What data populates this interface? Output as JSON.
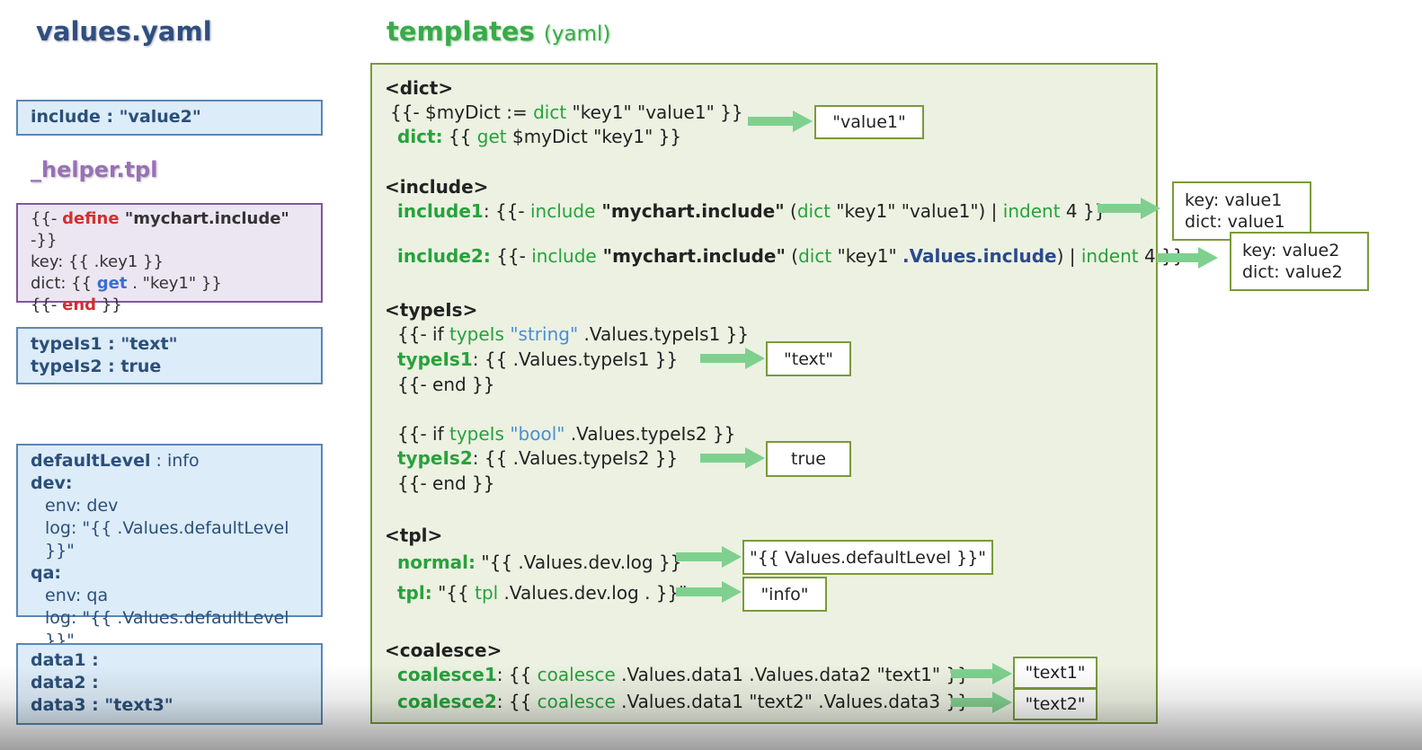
{
  "left": {
    "title": "values.yaml",
    "include_box": {
      "key": "include",
      "sep": " : ",
      "val": "\"value2\""
    },
    "helper_title": "_helper.tpl",
    "helper": {
      "l1_open": "{{- ",
      "l1_kw": "define",
      "l1_name": " \"mychart.include\"",
      "l1_close": " -}}",
      "l2": "key: {{ .key1 }}",
      "l3_pre": "dict: {{ ",
      "l3_kw": "get",
      "l3_post": " . \"key1\" }}",
      "l4_open": "{{- ",
      "l4_kw": "end",
      "l4_close": " }}"
    },
    "typeis_box": {
      "l1": "typeIs1 : \"text\"",
      "l2": "typeIs2 : true"
    },
    "level_box": {
      "l1_key": "defaultLevel",
      "l1_sep": " : ",
      "l1_val": "info",
      "l2": "dev:",
      "l3": "env: dev",
      "l4": "log: \"{{ .Values.defaultLevel }}\"",
      "l5": "qa:",
      "l6": "env: qa",
      "l7": "log: \"{{ .Values.defaultLevel }}\""
    },
    "data_box": {
      "l1": "data1 :",
      "l2": "data2 :",
      "l3": "data3 : \"text3\""
    }
  },
  "right": {
    "title": "templates",
    "subtitle": "(yaml)",
    "dict": {
      "header": "<dict>",
      "l1_a": "{{- $myDict := ",
      "l1_kw": "dict",
      "l1_b": " \"key1\" \"value1\" }}",
      "l2_key": "dict:",
      "l2_a": " {{ ",
      "l2_kw": "get",
      "l2_b": " $myDict \"key1\" }}",
      "out": "\"value1\""
    },
    "include": {
      "header": "<include>",
      "i1_key": "include1",
      "i1_a": ": {{- ",
      "i1_kw": "include",
      "i1_name": " \"mychart.include\"",
      "i1_b": " (",
      "i1_kw2": "dict",
      "i1_c": " \"key1\" \"value1\") | ",
      "i1_kw3": "indent",
      "i1_d": " 4 }}",
      "i2_key": "include2:",
      "i2_a": " {{- ",
      "i2_kw": "include",
      "i2_name": " \"mychart.include\"",
      "i2_b": " (",
      "i2_kw2": "dict",
      "i2_c": " \"key1\" ",
      "i2_val": ".Values.include",
      "i2_d": ") | ",
      "i2_kw3": "indent",
      "i2_e": " 4 }}",
      "out1_l1": "key: value1",
      "out1_l2": "dict: value1",
      "out2_l1": "key: value2",
      "out2_l2": "dict: value2"
    },
    "typeis": {
      "header": "<typeIs>",
      "a1_a": "{{- if ",
      "a1_kw": "typeIs",
      "a1_str": " \"string\"",
      "a1_b": " .Values.typeIs1 }}",
      "a2_key": "typeIs1",
      "a2_b": ": {{ .Values.typeIs1 }}",
      "a3": "{{- end }}",
      "out1": "\"text\"",
      "b1_a": "{{- if ",
      "b1_kw": "typeIs",
      "b1_str": " \"bool\"",
      "b1_b": " .Values.typeIs2 }}",
      "b2_key": "typeIs2",
      "b2_b": ": {{ .Values.typeIs2 }}",
      "b3": "{{- end }}",
      "out2": "true"
    },
    "tpl": {
      "header": "<tpl>",
      "n_key": "normal:",
      "n_b": " \"{{ .Values.dev.log }}\"",
      "t_key": "tpl:",
      "t_a": " \"{{ ",
      "t_kw": "tpl",
      "t_b": " .Values.dev.log . }}\"",
      "out1": "\"{{ Values.defaultLevel }}\"",
      "out2": "\"info\""
    },
    "coalesce": {
      "header": "<coalesce>",
      "c1_key": "coalesce1",
      "c1_a": ":   {{ ",
      "c1_kw": "coalesce",
      "c1_b": " .Values.data1 .Values.data2 \"text1\" }}",
      "c2_key": "coalesce2",
      "c2_a": ":   {{ ",
      "c2_kw": "coalesce",
      "c2_b": " .Values.data1 \"text2\" .Values.data3 }}",
      "out1": "\"text1\"",
      "out2": "\"text2\""
    }
  },
  "colors": {
    "arrow": "#7fd08f",
    "green": "#27a23b",
    "navy": "#2a4a8a"
  }
}
